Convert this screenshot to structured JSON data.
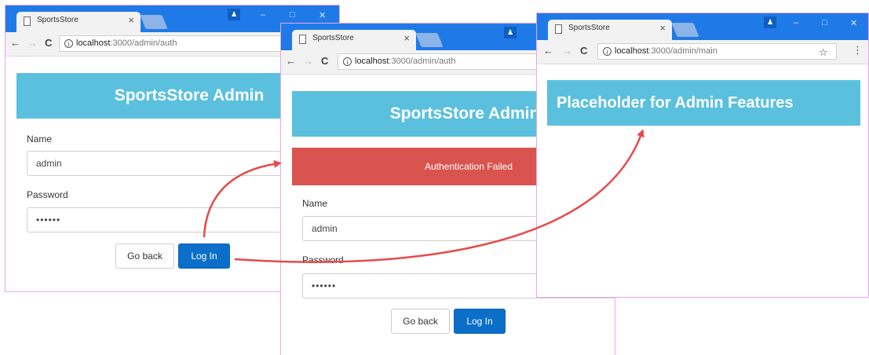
{
  "windows": [
    {
      "tab_title": "SportsStore",
      "close_glyph": "×",
      "url_host": "localhost",
      "url_path": ":3000/admin/auth",
      "banner": "SportsStore Admin",
      "name_label": "Name",
      "name_value": "admin",
      "password_label": "Password",
      "password_value": "••••••",
      "go_back": "Go back",
      "log_in": "Log In"
    },
    {
      "tab_title": "SportsStore",
      "close_glyph": "×",
      "url_host": "localhost",
      "url_path": ":3000/admin/auth",
      "banner": "SportsStore Admin",
      "alert": "Authentication Failed",
      "name_label": "Name",
      "name_value": "admin",
      "password_label": "Password",
      "password_value": "••••••",
      "go_back": "Go back",
      "log_in": "Log In"
    },
    {
      "tab_title": "SportsStore",
      "close_glyph": "×",
      "url_host": "localhost",
      "url_path": ":3000/admin/main",
      "banner": "Placeholder for Admin Features"
    }
  ],
  "toolbar": {
    "back_glyph": "←",
    "forward_glyph": "→",
    "reload_glyph": "C",
    "info_glyph": "i",
    "star_glyph": "☆",
    "menu_glyph": "⋮"
  },
  "window_controls": {
    "user_glyph": "♟",
    "minimize": "–",
    "maximize": "□",
    "close": "✕"
  },
  "colors": {
    "titlebar": "#1f7ae8",
    "banner": "#5bc0de",
    "alert": "#d9534f",
    "primary_button": "#0b6fc9",
    "arrow": "#e64a4a",
    "window_border": "#e8a6ee"
  },
  "icons": [
    "page-icon",
    "close-icon",
    "back-icon",
    "forward-icon",
    "reload-icon",
    "info-icon",
    "star-icon",
    "menu-icon",
    "user-icon",
    "minimize-icon",
    "maximize-icon",
    "window-close-icon",
    "arrow-icon"
  ]
}
